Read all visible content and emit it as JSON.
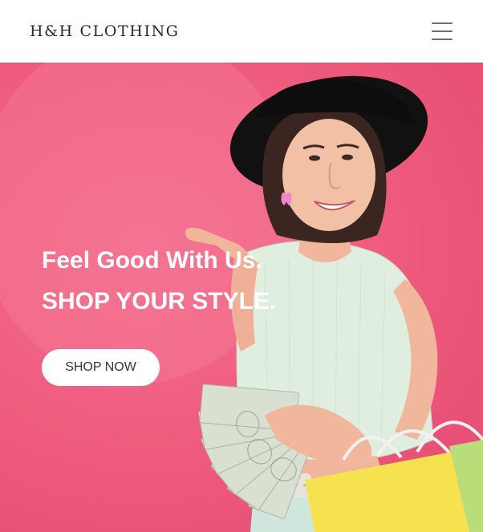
{
  "navbar": {
    "brand": "H&H CLOTHING",
    "menu_icon": "hamburger-menu-icon"
  },
  "hero": {
    "headline_line1": "Feel Good With Us.",
    "headline_line2": "SHOP YOUR STYLE.",
    "cta_label": "SHOP NOW",
    "image": "woman-with-money-and-shopping-bags"
  },
  "colors": {
    "hero_background": "#ef5d7f",
    "hero_text": "#ffffff",
    "button_background": "#ffffff",
    "button_text": "#333333"
  }
}
